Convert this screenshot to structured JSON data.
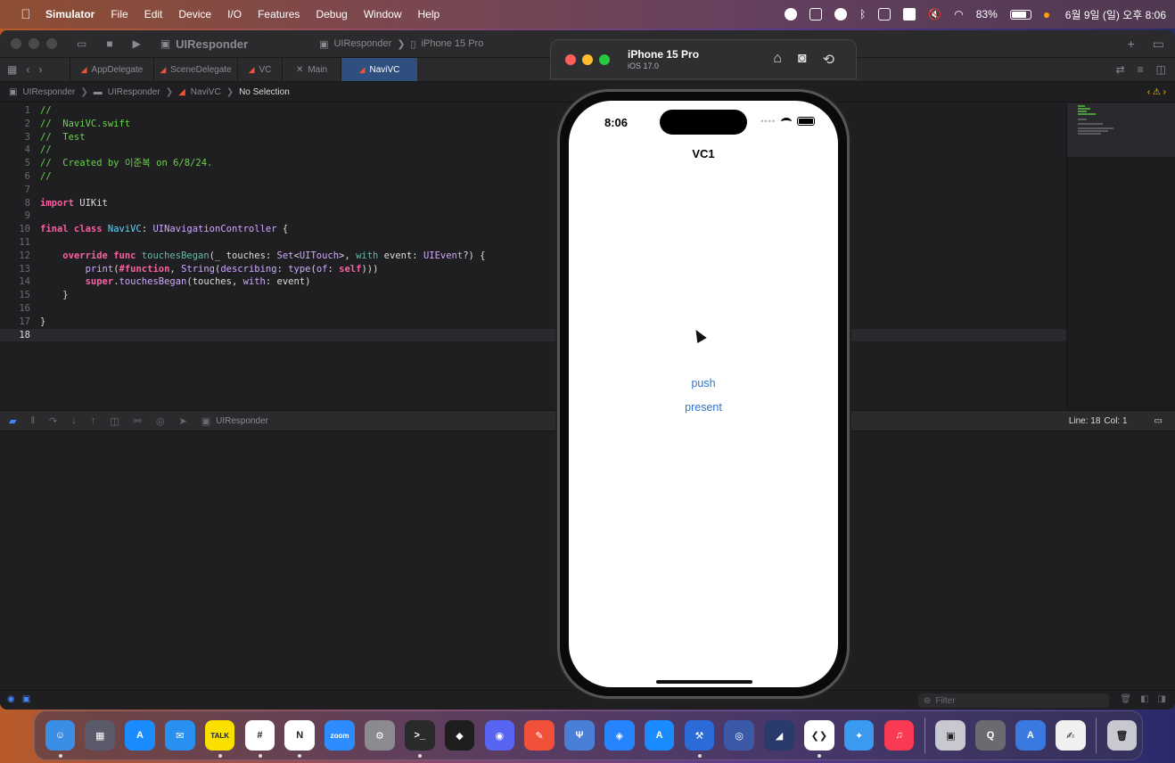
{
  "menubar": {
    "apple": "",
    "items": [
      "Simulator",
      "File",
      "Edit",
      "Device",
      "I/O",
      "Features",
      "Debug",
      "Window",
      "Help"
    ],
    "battery_percent": "83%",
    "datetime": "6월 9일 (일) 오후 8:06",
    "status_icons": [
      "record-icon",
      "n-icon",
      "leaf-icon",
      "bluetooth-icon",
      "play-icon",
      "layout-icon",
      "mute-icon",
      "wifi-icon"
    ]
  },
  "xcode": {
    "toolbar": {
      "project_title": "UIResponder",
      "scheme": "UIResponder",
      "device": "iPhone 15 Pro"
    },
    "tabs": [
      {
        "label": "AppDelegate",
        "icon": "swift-icon",
        "active": false
      },
      {
        "label": "SceneDelegate",
        "icon": "swift-icon",
        "active": false
      },
      {
        "label": "VC",
        "icon": "swift-icon",
        "active": false
      },
      {
        "label": "Main",
        "icon": "storyboard-icon",
        "active": false
      },
      {
        "label": "NaviVC",
        "icon": "swift-icon",
        "active": true
      }
    ],
    "jumpbar": [
      "UIResponder",
      "UIResponder",
      "NaviVC",
      "No Selection"
    ],
    "code": {
      "current_line": 18,
      "lines": [
        {
          "n": "1",
          "parts": [
            {
              "c": "c-com",
              "t": "//"
            }
          ]
        },
        {
          "n": "2",
          "parts": [
            {
              "c": "c-com",
              "t": "//  NaviVC.swift"
            }
          ]
        },
        {
          "n": "3",
          "parts": [
            {
              "c": "c-com",
              "t": "//  Test"
            }
          ]
        },
        {
          "n": "4",
          "parts": [
            {
              "c": "c-com",
              "t": "//"
            }
          ]
        },
        {
          "n": "5",
          "parts": [
            {
              "c": "c-com",
              "t": "//  Created by 이준복 on 6/8/24."
            }
          ]
        },
        {
          "n": "6",
          "parts": [
            {
              "c": "c-com",
              "t": "//"
            }
          ]
        },
        {
          "n": "7",
          "parts": []
        },
        {
          "n": "8",
          "parts": [
            {
              "c": "c-kw",
              "t": "import"
            },
            {
              "c": "c-plain",
              "t": " UIKit"
            }
          ]
        },
        {
          "n": "9",
          "parts": []
        },
        {
          "n": "10",
          "parts": [
            {
              "c": "c-kw",
              "t": "final class"
            },
            {
              "c": "c-plain",
              "t": " "
            },
            {
              "c": "c-type",
              "t": "NaviVC"
            },
            {
              "c": "c-plain",
              "t": ": "
            },
            {
              "c": "c-sys",
              "t": "UINavigationController"
            },
            {
              "c": "c-plain",
              "t": " {"
            }
          ]
        },
        {
          "n": "11",
          "parts": []
        },
        {
          "n": "12",
          "parts": [
            {
              "c": "c-plain",
              "t": "    "
            },
            {
              "c": "c-kw",
              "t": "override func"
            },
            {
              "c": "c-plain",
              "t": " "
            },
            {
              "c": "c-fn",
              "t": "touchesBegan"
            },
            {
              "c": "c-plain",
              "t": "(_ touches: "
            },
            {
              "c": "c-sys",
              "t": "Set"
            },
            {
              "c": "c-plain",
              "t": "<"
            },
            {
              "c": "c-sys",
              "t": "UITouch"
            },
            {
              "c": "c-plain",
              "t": ">, "
            },
            {
              "c": "c-fn",
              "t": "with"
            },
            {
              "c": "c-plain",
              "t": " event: "
            },
            {
              "c": "c-sys",
              "t": "UIEvent"
            },
            {
              "c": "c-plain",
              "t": "?) {"
            }
          ]
        },
        {
          "n": "13",
          "parts": [
            {
              "c": "c-plain",
              "t": "        "
            },
            {
              "c": "c-sys",
              "t": "print"
            },
            {
              "c": "c-plain",
              "t": "("
            },
            {
              "c": "c-kw",
              "t": "#function"
            },
            {
              "c": "c-plain",
              "t": ", "
            },
            {
              "c": "c-sys",
              "t": "String"
            },
            {
              "c": "c-plain",
              "t": "("
            },
            {
              "c": "c-sys",
              "t": "describing"
            },
            {
              "c": "c-plain",
              "t": ": "
            },
            {
              "c": "c-sys",
              "t": "type"
            },
            {
              "c": "c-plain",
              "t": "("
            },
            {
              "c": "c-sys",
              "t": "of"
            },
            {
              "c": "c-plain",
              "t": ": "
            },
            {
              "c": "c-kw",
              "t": "self"
            },
            {
              "c": "c-plain",
              "t": ")))"
            }
          ]
        },
        {
          "n": "14",
          "parts": [
            {
              "c": "c-plain",
              "t": "        "
            },
            {
              "c": "c-kw",
              "t": "super"
            },
            {
              "c": "c-plain",
              "t": "."
            },
            {
              "c": "c-sys",
              "t": "touchesBegan"
            },
            {
              "c": "c-plain",
              "t": "(touches, "
            },
            {
              "c": "c-sys",
              "t": "with"
            },
            {
              "c": "c-plain",
              "t": ": event)"
            }
          ]
        },
        {
          "n": "15",
          "parts": [
            {
              "c": "c-plain",
              "t": "    }"
            }
          ]
        },
        {
          "n": "16",
          "parts": []
        },
        {
          "n": "17",
          "parts": [
            {
              "c": "c-plain",
              "t": "}"
            }
          ]
        },
        {
          "n": "18",
          "parts": []
        }
      ]
    },
    "debugbar": {
      "target_label": "UIResponder",
      "line_label": "Line: 18",
      "col_label": "Col: 1"
    },
    "filter_placeholder": "Filter"
  },
  "simulator": {
    "device_name": "iPhone 15 Pro",
    "os_version": "iOS 17.0",
    "status_time": "8:06",
    "nav_title": "VC1",
    "buttons": {
      "push": "push",
      "present": "present"
    }
  },
  "dock": {
    "apps": [
      {
        "name": "finder",
        "color": "#3a8ee6",
        "label": "☺",
        "running": true
      },
      {
        "name": "launchpad",
        "color": "#5a5a6a",
        "label": "▦",
        "running": false
      },
      {
        "name": "app-store",
        "color": "#1a8cff",
        "label": "A",
        "running": false
      },
      {
        "name": "mail",
        "color": "#2a90f0",
        "label": "✉",
        "running": false
      },
      {
        "name": "kakaotalk",
        "color": "#f9e000",
        "label": "TALK",
        "running": true
      },
      {
        "name": "slack",
        "color": "#ffffff",
        "label": "#",
        "running": true
      },
      {
        "name": "notion",
        "color": "#ffffff",
        "label": "N",
        "running": true
      },
      {
        "name": "zoom",
        "color": "#2d8cff",
        "label": "zoom",
        "running": false
      },
      {
        "name": "system-settings",
        "color": "#8a8a90",
        "label": "⚙",
        "running": false
      },
      {
        "name": "terminal",
        "color": "#2a2a2a",
        "label": ">_",
        "running": true
      },
      {
        "name": "figma",
        "color": "#1e1e1e",
        "label": "◆",
        "running": false
      },
      {
        "name": "discord",
        "color": "#5865f2",
        "label": "◉",
        "running": false
      },
      {
        "name": "swift-playgrounds",
        "color": "#f05138",
        "label": "✎",
        "running": false
      },
      {
        "name": "fork",
        "color": "#4a7fd8",
        "label": "Ψ",
        "running": false
      },
      {
        "name": "sourcetree",
        "color": "#2684ff",
        "label": "◈",
        "running": false
      },
      {
        "name": "instruments",
        "color": "#1a8cff",
        "label": "A",
        "running": false
      },
      {
        "name": "xcode",
        "color": "#2a6bd8",
        "label": "⚒",
        "running": true
      },
      {
        "name": "proxyman",
        "color": "#3a5aa8",
        "label": "◎",
        "running": false
      },
      {
        "name": "teal-app",
        "color": "#2a3a6a",
        "label": "◢",
        "running": false
      },
      {
        "name": "vscode",
        "color": "#ffffff",
        "label": "❮❯",
        "running": true
      },
      {
        "name": "safari",
        "color": "#3a9af0",
        "label": "✦",
        "running": false
      },
      {
        "name": "music",
        "color": "#fa3a52",
        "label": "♫",
        "running": false
      },
      {
        "name": "preview",
        "color": "#c8c8d0",
        "label": "▣",
        "running": false
      },
      {
        "name": "quicktime",
        "color": "#6a6a70",
        "label": "Q",
        "running": false
      },
      {
        "name": "xcode-archive",
        "color": "#3a7ae0",
        "label": "A",
        "running": false
      },
      {
        "name": "textedit",
        "color": "#f0f0f0",
        "label": "✍",
        "running": false
      },
      {
        "name": "trash",
        "color": "#c8c8d0",
        "label": "🗑",
        "running": false
      }
    ]
  }
}
